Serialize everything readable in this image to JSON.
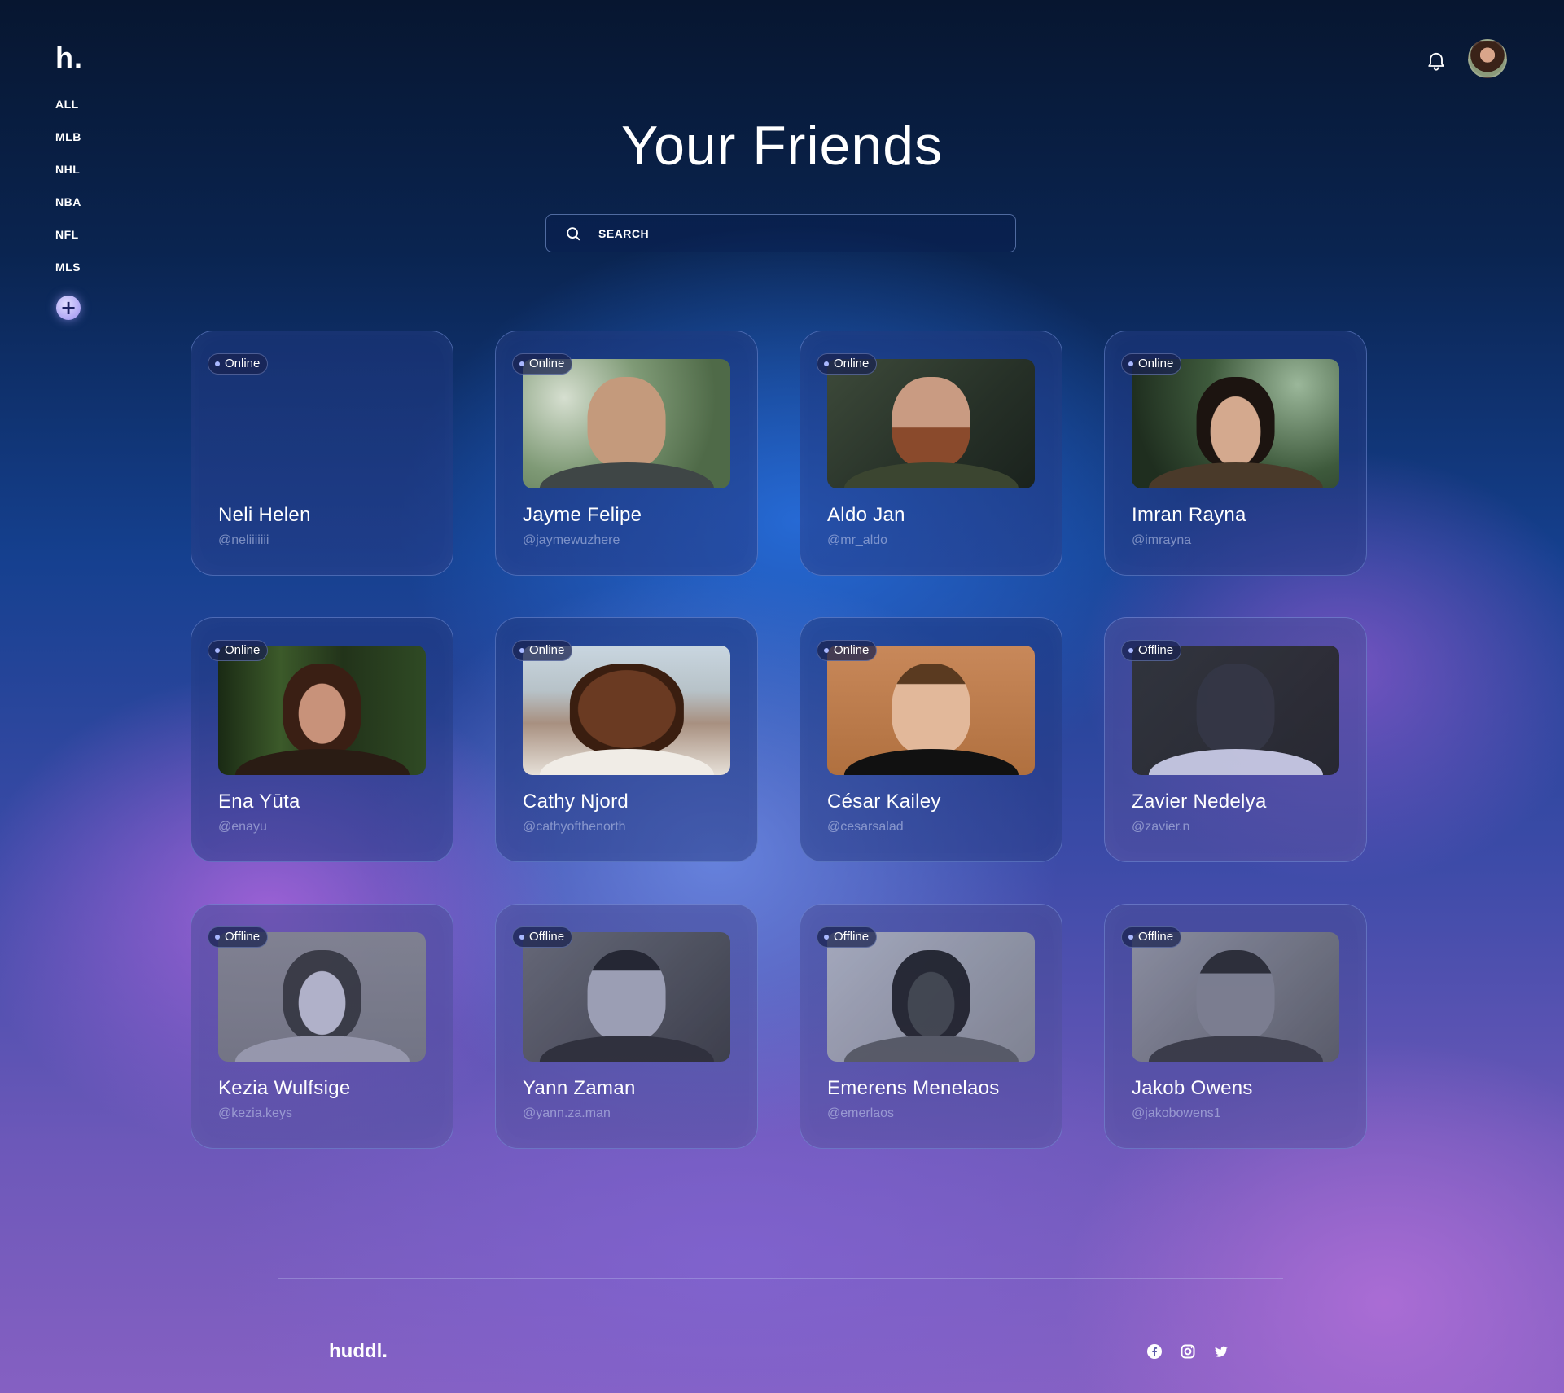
{
  "app": {
    "logo": "h.",
    "footer_logo": "huddl."
  },
  "sidebar": {
    "items": [
      {
        "label": "ALL"
      },
      {
        "label": "MLB"
      },
      {
        "label": "NHL"
      },
      {
        "label": "NBA"
      },
      {
        "label": "NFL"
      },
      {
        "label": "MLS"
      }
    ],
    "add_label": "+"
  },
  "header": {
    "title": "Your Friends",
    "bell_icon": "bell-icon",
    "avatar": "user-avatar"
  },
  "search": {
    "placeholder": "SEARCH",
    "value": ""
  },
  "friends": [
    {
      "name": "Neli Helen",
      "handle": "@neliiiiiii",
      "status": "Online",
      "photo": false
    },
    {
      "name": "Jayme Felipe",
      "handle": "@jaymewuzhere",
      "status": "Online",
      "photo": true
    },
    {
      "name": "Aldo Jan",
      "handle": "@mr_aldo",
      "status": "Online",
      "photo": true
    },
    {
      "name": "Imran Rayna",
      "handle": "@imrayna",
      "status": "Online",
      "photo": true
    },
    {
      "name": "Ena Yūta",
      "handle": "@enayu",
      "status": "Online",
      "photo": true
    },
    {
      "name": "Cathy Njord",
      "handle": "@cathyofthenorth",
      "status": "Online",
      "photo": true
    },
    {
      "name": "César Kailey",
      "handle": "@cesarsalad",
      "status": "Online",
      "photo": true
    },
    {
      "name": "Zavier Nedelya",
      "handle": "@zavier.n",
      "status": "Offline",
      "photo": true
    },
    {
      "name": "Kezia Wulfsige",
      "handle": "@kezia.keys",
      "status": "Offline",
      "photo": true
    },
    {
      "name": "Yann Zaman",
      "handle": "@yann.za.man",
      "status": "Offline",
      "photo": true
    },
    {
      "name": "Emerens Menelaos",
      "handle": "@emerlaos",
      "status": "Offline",
      "photo": true
    },
    {
      "name": "Jakob Owens",
      "handle": "@jakobowens1",
      "status": "Offline",
      "photo": true
    }
  ],
  "footer": {
    "social": [
      "facebook-icon",
      "instagram-icon",
      "twitter-icon"
    ]
  },
  "colors": {
    "accent": "#9a8ff0",
    "status_dot": "#a9b8ff"
  }
}
